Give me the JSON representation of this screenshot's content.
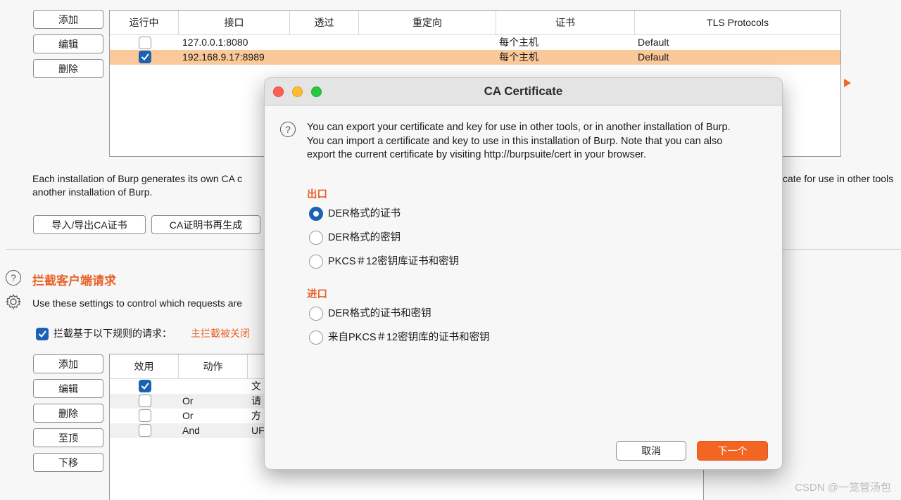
{
  "proxy_buttons": {
    "add": "添加",
    "edit": "编辑",
    "delete": "删除"
  },
  "proxy_table": {
    "headers": [
      "运行中",
      "接口",
      "透过",
      "重定向",
      "证书",
      "TLS Protocols"
    ],
    "rows": [
      {
        "running": false,
        "interface": "127.0.0.1:8080",
        "invisible": "",
        "redirect": "",
        "cert": "每个主机",
        "tls": "Default",
        "selected": false
      },
      {
        "running": true,
        "interface": "192.168.9.17:8989",
        "invisible": "",
        "redirect": "",
        "cert": "每个主机",
        "tls": "Default",
        "selected": true
      }
    ]
  },
  "ca_text": {
    "left_line1": "Each installation of Burp generates its own CA c",
    "left_line2": "another installation of Burp.",
    "right_line1": "cate for use in other tools"
  },
  "ca_buttons": {
    "import_export": "导入/导出CA证书",
    "regenerate": "CA证明书再生成"
  },
  "intercept_section": {
    "title": "拦截客户端请求",
    "desc": "Use these settings to control which requests are",
    "checkbox_label": "拦截基于以下规则的请求：",
    "checkbox_checked": true,
    "status": "主拦截被关闭"
  },
  "rules_buttons": {
    "add": "添加",
    "edit": "编辑",
    "delete": "删除",
    "top": "至顶",
    "down": "下移"
  },
  "rules_table": {
    "headers": [
      "效用",
      "动作"
    ],
    "rows": [
      {
        "enabled": true,
        "op": "",
        "match": "文"
      },
      {
        "enabled": false,
        "op": "Or",
        "match": "请"
      },
      {
        "enabled": false,
        "op": "Or",
        "match": "方"
      },
      {
        "enabled": false,
        "op": "And",
        "match": "UF"
      }
    ]
  },
  "dialog": {
    "title": "CA Certificate",
    "info_line1": "You can export your certificate and key for use in other tools, or in another installation of Burp.",
    "info_line2": "You can import a certificate and key to use in this installation of Burp. Note that you can also",
    "info_line3": "export the current certificate by visiting http://burpsuite/cert in your browser.",
    "export_label": "出口",
    "export_options": [
      "DER格式的证书",
      "DER格式的密钥",
      "PKCS＃12密钥库证书和密钥"
    ],
    "import_label": "进口",
    "import_options": [
      "DER格式的证书和密钥",
      "来自PKCS＃12密钥库的证书和密钥"
    ],
    "selected_option": "DER格式的证书",
    "cancel": "取消",
    "next": "下一个"
  },
  "watermark": "CSDN @一笼管汤包",
  "colors": {
    "accent_orange": "#e8622a",
    "selected_row": "#fbc89a",
    "checkbox_blue": "#1a63b4",
    "next_button": "#f26522"
  },
  "icons": [
    "question-icon",
    "gear-icon",
    "checkmark-icon",
    "expand-arrow-icon"
  ]
}
